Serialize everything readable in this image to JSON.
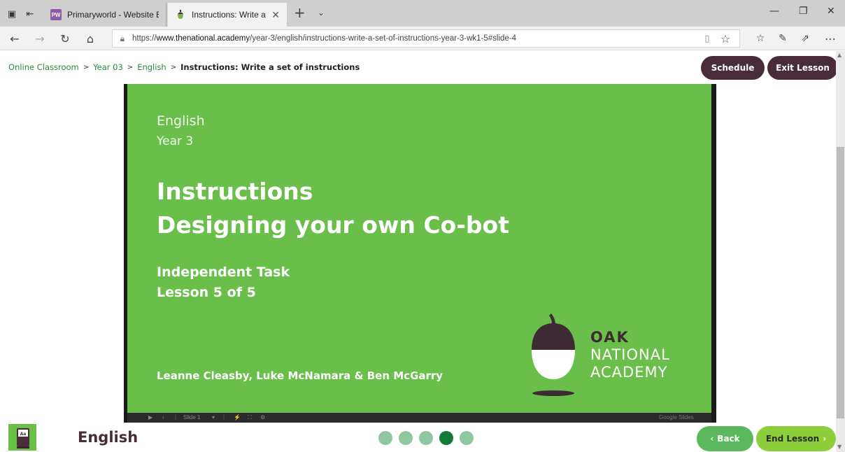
{
  "browser": {
    "tabs": [
      {
        "title": "Primaryworld - Website Edit",
        "favicon_text": "PW"
      },
      {
        "title": "Instructions: Write a set"
      }
    ],
    "url": {
      "scheme": "https://",
      "host": "www.thenational.academy",
      "path": "/year-3/english/instructions-write-a-set-of-instructions-year-3-wk1-5#slide-4"
    }
  },
  "breadcrumb": {
    "items": [
      "Online Classroom",
      "Year 03",
      "English"
    ],
    "current": "Instructions: Write a set of instructions"
  },
  "header_buttons": {
    "schedule": "Schedule",
    "exit": "Exit Lesson"
  },
  "slide": {
    "subject": "English",
    "year": "Year 3",
    "title_line1": "Instructions",
    "title_line2": "Designing your own Co-bot",
    "task": "Independent Task",
    "lesson": "Lesson 5 of 5",
    "authors": "Leanne Cleasby, Luke McNamara & Ben McGarry",
    "logo": {
      "line1": "OAK",
      "line2": "NATIONAL",
      "line3": "ACADEMY"
    },
    "controls": {
      "slide_label": "Slide 1",
      "brand": "Google Slides"
    }
  },
  "footer": {
    "subject": "English",
    "progress": {
      "total": 5,
      "current": 4
    },
    "back": "Back",
    "end": "End Lesson"
  },
  "colors": {
    "slide_green": "#6abf4b",
    "brand_plum": "#4a2b3a",
    "dot_active": "#157a35",
    "dot_inactive": "#8fc8a0",
    "back_green": "#5cb85c",
    "end_green": "#8ccf3a"
  }
}
